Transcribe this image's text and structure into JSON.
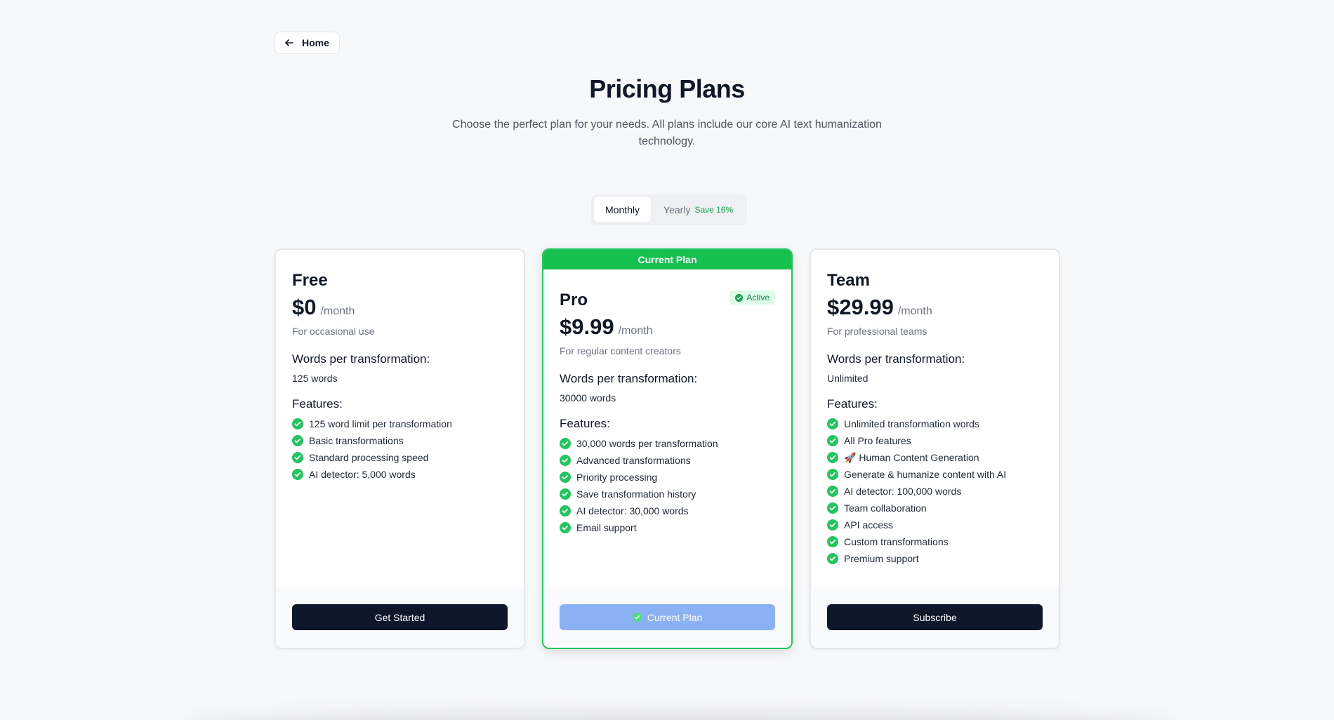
{
  "nav": {
    "home_label": "Home"
  },
  "header": {
    "title": "Pricing Plans",
    "subtitle": "Choose the perfect plan for your needs. All plans include our core AI text humanization technology."
  },
  "billing_toggle": {
    "monthly_label": "Monthly",
    "yearly_label": "Yearly",
    "yearly_badge": "Save 16%",
    "selected": "Monthly"
  },
  "plans": [
    {
      "name": "Free",
      "price": "$0",
      "period": "/month",
      "description": "For occasional use",
      "words_label": "Words per transformation:",
      "words_value": "125 words",
      "features_label": "Features:",
      "features": [
        "125 word limit per transformation",
        "Basic transformations",
        "Standard processing speed",
        "AI detector: 5,000 words"
      ],
      "cta": "Get Started"
    },
    {
      "name": "Pro",
      "banner": "Current Plan",
      "badge": "Active",
      "price": "$9.99",
      "period": "/month",
      "description": "For regular content creators",
      "words_label": "Words per transformation:",
      "words_value": "30000 words",
      "features_label": "Features:",
      "features": [
        "30,000 words per transformation",
        "Advanced transformations",
        "Priority processing",
        "Save transformation history",
        "AI detector: 30,000 words",
        "Email support"
      ],
      "cta": "Current Plan"
    },
    {
      "name": "Team",
      "price": "$29.99",
      "period": "/month",
      "description": "For professional teams",
      "words_label": "Words per transformation:",
      "words_value": "Unlimited",
      "features_label": "Features:",
      "features": [
        "Unlimited transformation words",
        "All Pro features",
        "🚀 Human Content Generation",
        "Generate & humanize content with AI",
        "AI detector: 100,000 words",
        "Team collaboration",
        "API access",
        "Custom transformations",
        "Premium support"
      ],
      "cta": "Subscribe"
    }
  ],
  "colors": {
    "accent_green": "#16c04f",
    "check_green": "#22c55e",
    "dark_button": "#0f172a",
    "current_button": "#8bb1f5"
  }
}
